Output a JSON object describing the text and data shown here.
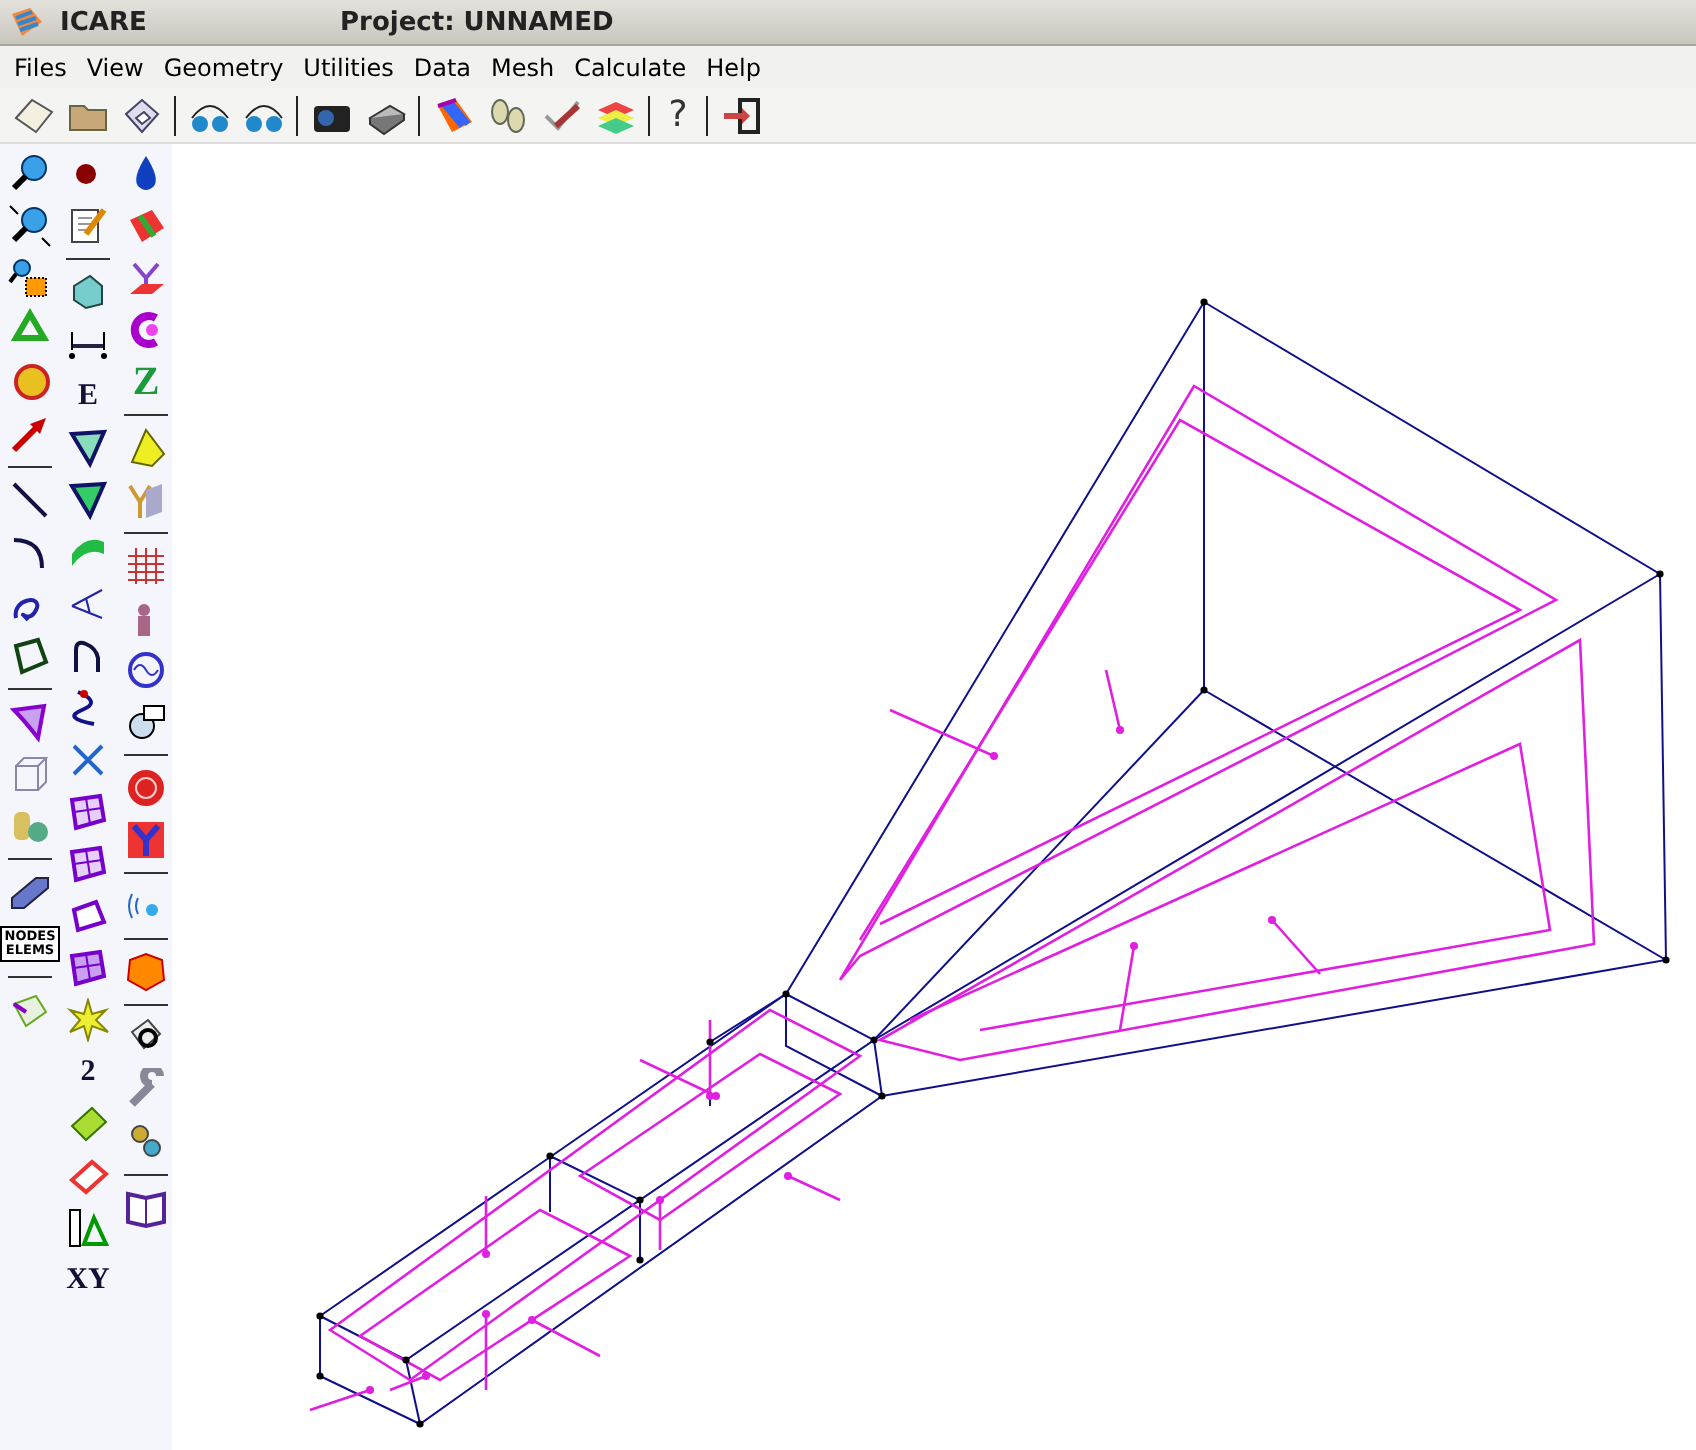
{
  "window": {
    "app_name": "ICARE",
    "project": "Project: UNNAMED"
  },
  "menu": [
    "Files",
    "View",
    "Geometry",
    "Utilities",
    "Data",
    "Mesh",
    "Calculate",
    "Help"
  ],
  "toolbar": [
    {
      "kind": "tool"
    },
    {
      "kind": "tool"
    },
    {
      "kind": "tool"
    },
    {
      "kind": "separator"
    },
    {
      "kind": "tool"
    },
    {
      "kind": "tool"
    },
    {
      "kind": "separator"
    },
    {
      "kind": "tool"
    },
    {
      "kind": "tool"
    },
    {
      "kind": "separator"
    },
    {
      "kind": "tool"
    },
    {
      "kind": "tool"
    },
    {
      "kind": "tool"
    },
    {
      "kind": "tool"
    },
    {
      "kind": "separator"
    },
    {
      "kind": "glyph",
      "text": "?"
    },
    {
      "kind": "separator"
    },
    {
      "kind": "tool"
    }
  ],
  "tool_palette": {
    "columns": [
      [
        {
          "kind": "tool"
        },
        {
          "kind": "tool"
        },
        {
          "kind": "tool"
        },
        {
          "kind": "tool"
        },
        {
          "kind": "tool"
        },
        {
          "kind": "tool"
        },
        {
          "kind": "separator"
        },
        {
          "kind": "tool"
        },
        {
          "kind": "tool"
        },
        {
          "kind": "tool"
        },
        {
          "kind": "tool"
        },
        {
          "kind": "separator"
        },
        {
          "kind": "tool"
        },
        {
          "kind": "tool"
        },
        {
          "kind": "tool"
        },
        {
          "kind": "separator"
        },
        {
          "kind": "tool"
        },
        {
          "kind": "label_box",
          "lines": [
            "NODES",
            "ELEMS"
          ]
        },
        {
          "kind": "separator"
        },
        {
          "kind": "tool"
        }
      ],
      [
        {
          "kind": "tool"
        },
        {
          "kind": "tool"
        },
        {
          "kind": "separator"
        },
        {
          "kind": "tool"
        },
        {
          "kind": "tool"
        },
        {
          "kind": "glyph",
          "text": "E"
        },
        {
          "kind": "tool"
        },
        {
          "kind": "tool"
        },
        {
          "kind": "tool"
        },
        {
          "kind": "tool"
        },
        {
          "kind": "tool"
        },
        {
          "kind": "tool"
        },
        {
          "kind": "tool"
        },
        {
          "kind": "tool"
        },
        {
          "kind": "tool"
        },
        {
          "kind": "tool"
        },
        {
          "kind": "tool"
        },
        {
          "kind": "tool"
        },
        {
          "kind": "glyph",
          "text": "2"
        },
        {
          "kind": "tool"
        },
        {
          "kind": "tool"
        },
        {
          "kind": "tool"
        },
        {
          "kind": "glyph",
          "text": "XY"
        }
      ],
      [
        {
          "kind": "tool"
        },
        {
          "kind": "tool"
        },
        {
          "kind": "tool"
        },
        {
          "kind": "tool"
        },
        {
          "kind": "glyph",
          "text": "Z"
        },
        {
          "kind": "separator"
        },
        {
          "kind": "tool"
        },
        {
          "kind": "tool"
        },
        {
          "kind": "separator"
        },
        {
          "kind": "tool"
        },
        {
          "kind": "tool"
        },
        {
          "kind": "tool"
        },
        {
          "kind": "tool"
        },
        {
          "kind": "separator"
        },
        {
          "kind": "tool"
        },
        {
          "kind": "tool"
        },
        {
          "kind": "separator"
        },
        {
          "kind": "tool"
        },
        {
          "kind": "separator"
        },
        {
          "kind": "tool"
        },
        {
          "kind": "separator"
        },
        {
          "kind": "tool"
        },
        {
          "kind": "tool"
        },
        {
          "kind": "tool"
        },
        {
          "kind": "separator"
        },
        {
          "kind": "tool"
        }
      ]
    ]
  }
}
